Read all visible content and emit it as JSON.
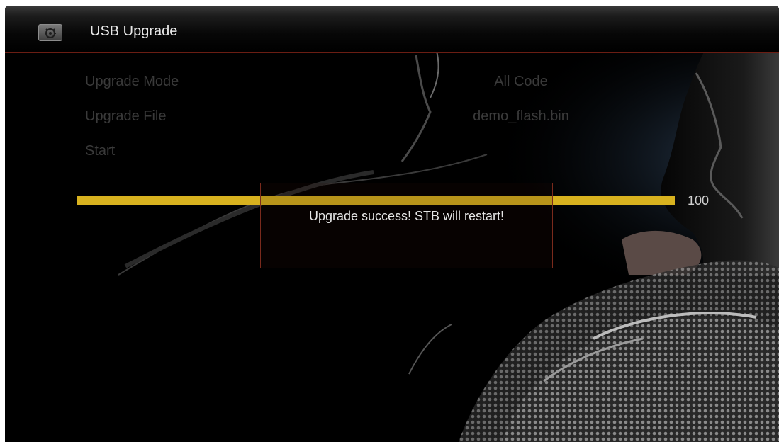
{
  "header": {
    "title": "USB Upgrade",
    "icon": "upgrade-settings-icon"
  },
  "menu": {
    "items": [
      {
        "label": "Upgrade Mode",
        "value": "All Code"
      },
      {
        "label": "Upgrade File",
        "value": "demo_flash.bin"
      },
      {
        "label": "Start",
        "value": ""
      }
    ]
  },
  "progress": {
    "percent": 100,
    "label": "100"
  },
  "dialog": {
    "message": "Upgrade success! STB will restart!"
  },
  "colors": {
    "accent_yellow": "#d8b21f",
    "border_red": "#7a2a1c",
    "menu_text_dim": "#3a3a3a"
  }
}
